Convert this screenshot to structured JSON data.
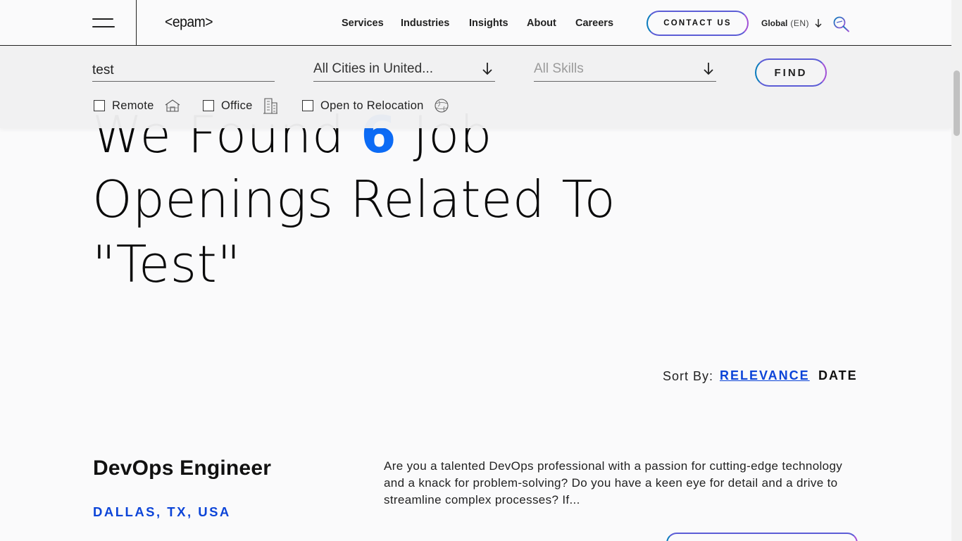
{
  "header": {
    "logo": "<epam>",
    "nav": [
      "Services",
      "Industries",
      "Insights",
      "About",
      "Careers"
    ],
    "contact_label": "CONTACT US",
    "region_label": "Global",
    "language_label": "(EN)"
  },
  "filters": {
    "keyword_value": "test",
    "city_value": "All Cities in United...",
    "skills_placeholder": "All Skills",
    "find_label": "FIND",
    "options": [
      "Remote",
      "Office",
      "Open to Relocation"
    ]
  },
  "results": {
    "headline_prefix": "We Found",
    "count": "6",
    "headline_suffix_1": "Job",
    "headline_line_2": "Openings Related To",
    "headline_line_3": "\"Test\""
  },
  "sort": {
    "label": "Sort By:",
    "relevance_label": "RELEVANCE",
    "date_label": "DATE"
  },
  "jobs": [
    {
      "title": "DevOps Engineer",
      "location": "DALLAS, TX, USA",
      "description": "Are you a talented DevOps professional with a passion for cutting-edge technology and a knack for problem-solving? Do you have a keen eye for detail and a drive to streamline complex processes? If..."
    }
  ],
  "colors": {
    "accent_blue": "#0c44d8",
    "count_blue": "#0c6bf5",
    "gradient_start": "#0b7bbd",
    "gradient_end": "#a152d6"
  }
}
